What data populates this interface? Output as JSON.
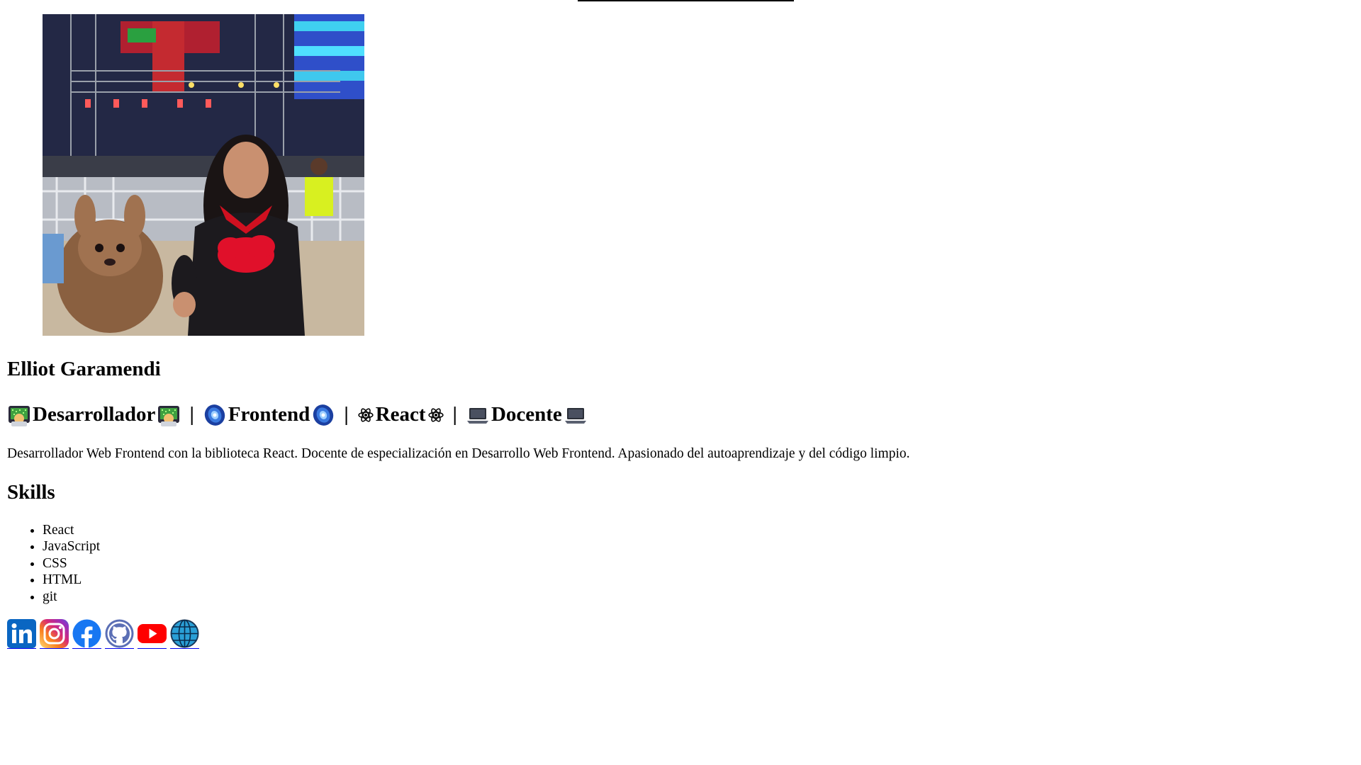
{
  "profile": {
    "photo_alt": "Elliot Garamendi",
    "name": "Elliot Garamendi",
    "tagline": {
      "developer": "Desarrollador",
      "frontend": "Frontend",
      "react": "React",
      "teacher": "Docente",
      "separator": "|"
    },
    "bio": "Desarrollador Web Frontend con la biblioteca React. Docente de especialización en Desarrollo Web Frontend. Apasionado del autoaprendizaje y del código limpio."
  },
  "skills": {
    "title": "Skills",
    "items": [
      "React",
      "JavaScript",
      "CSS",
      "HTML",
      "git"
    ]
  },
  "socials": [
    {
      "icon": "linkedin-icon",
      "color": "#0a66c2"
    },
    {
      "icon": "instagram-icon",
      "color": "#e1306c"
    },
    {
      "icon": "facebook-icon",
      "color": "#1877f2"
    },
    {
      "icon": "github-icon",
      "color": "#5b6fb5"
    },
    {
      "icon": "youtube-icon",
      "color": "#ff0000"
    },
    {
      "icon": "globe-icon",
      "color": "#2a9fd6"
    }
  ],
  "colors": {
    "text": "#000000",
    "link": "#0000ee",
    "background": "#ffffff"
  }
}
